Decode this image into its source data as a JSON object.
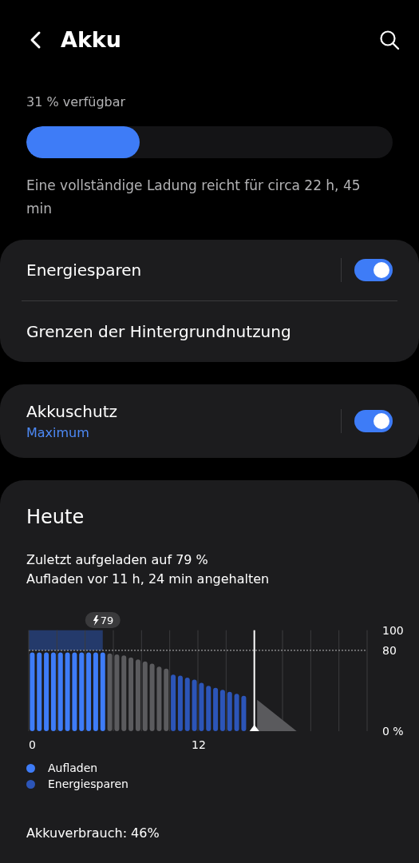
{
  "header": {
    "title": "Akku"
  },
  "battery": {
    "available": "31 % verfügbar",
    "level": 0.31,
    "estimate": "Eine vollständige Ladung reicht für circa 22 h, 45 min"
  },
  "groups": [
    {
      "rows": [
        {
          "kind": "toggle",
          "label": "Energiesparen",
          "on": true
        },
        {
          "kind": "link",
          "label": "Grenzen der Hintergrundnutzung"
        }
      ]
    },
    {
      "rows": [
        {
          "kind": "toggle",
          "label": "Akkuschutz",
          "sublabel": "Maximum",
          "on": true
        }
      ]
    }
  ],
  "today": {
    "title": "Heute",
    "info": [
      "Zuletzt aufgeladen auf 79 %",
      "Aufladen vor 11 h, 24 min angehalten"
    ],
    "chart_data": {
      "type": "bar",
      "x": [
        0,
        0.5,
        1,
        1.5,
        2,
        2.5,
        3,
        3.5,
        4,
        4.5,
        5,
        5.5,
        6,
        6.5,
        7,
        7.5,
        8,
        8.5,
        9,
        9.5,
        10,
        10.5,
        11,
        11.5,
        12,
        12.5,
        13,
        13.5,
        14,
        14.5,
        15
      ],
      "series": [
        {
          "name": "Aufladen",
          "color": "#3e7cf7",
          "values": [
            78,
            78,
            78,
            78,
            78,
            78,
            78,
            78,
            78,
            78,
            78,
            null,
            null,
            null,
            null,
            null,
            null,
            null,
            null,
            null,
            null,
            null,
            null,
            null,
            null,
            null,
            null,
            null,
            null,
            null,
            null
          ]
        },
        {
          "color": "#5b5b5e",
          "values": [
            null,
            null,
            null,
            null,
            null,
            null,
            null,
            null,
            null,
            null,
            null,
            77,
            76,
            75,
            73,
            71,
            69,
            67,
            64,
            62,
            null,
            null,
            null,
            null,
            null,
            null,
            null,
            null,
            null,
            null,
            null
          ]
        },
        {
          "name": "Energiesparen",
          "color": "#2c55b8",
          "values": [
            null,
            null,
            null,
            null,
            null,
            null,
            null,
            null,
            null,
            null,
            null,
            null,
            null,
            null,
            null,
            null,
            null,
            null,
            null,
            null,
            56,
            55,
            53,
            51,
            48,
            45,
            43,
            41,
            39,
            37,
            35
          ]
        }
      ],
      "xlim": [
        0,
        24
      ],
      "ylim": [
        0,
        100
      ],
      "xticks": [
        0,
        12
      ],
      "yticks": [
        {
          "value": 0,
          "label": "0 %"
        },
        80,
        100
      ],
      "stacked": false,
      "ref_lines": [
        {
          "axis": "y",
          "value": 80
        },
        {
          "axis": "x",
          "value": 16
        }
      ],
      "bands": [
        {
          "axis": "x",
          "from": 0,
          "to": 5.25
        }
      ],
      "annotations": [
        "79"
      ]
    },
    "usage": "Akkuverbrauch: 46%"
  }
}
